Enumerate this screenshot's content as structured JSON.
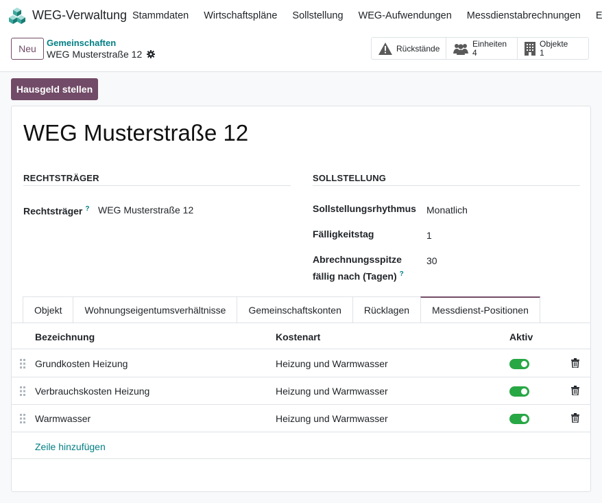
{
  "app": {
    "name": "WEG-Verwaltung"
  },
  "menu": [
    "Stammdaten",
    "Wirtschaftspläne",
    "Sollstellung",
    "WEG-Aufwendungen",
    "Messdienstabrechnungen",
    "Eröffn"
  ],
  "control": {
    "new_label": "Neu",
    "breadcrumb_parent": "Gemeinschaften",
    "breadcrumb_current": "WEG Musterstraße 12"
  },
  "smart_buttons": {
    "rueckstaende": "Rückstände",
    "einheiten_label": "Einheiten",
    "einheiten_count": "4",
    "objekte_label": "Objekte",
    "objekte_count": "1"
  },
  "primary_action": "Hausgeld stellen",
  "record": {
    "title": "WEG Musterstraße 12",
    "group_left": "RECHTSTRÄGER",
    "group_right": "SOLLSTELLUNG",
    "rechtstraeger_label": "Rechtsträger",
    "rechtstraeger_value": "WEG Musterstraße 12",
    "help_mark": "?",
    "rhythmus_label": "Sollstellungsrhythmus",
    "rhythmus_value": "Monatlich",
    "faelligkeit_label": "Fälligkeitstag",
    "faelligkeit_value": "1",
    "spitze_label_1": "Abrechnungsspitze",
    "spitze_label_2": "fällig nach (Tagen)",
    "spitze_value": "30"
  },
  "tabs": [
    "Objekt",
    "Wohnungseigentumsverhältnisse",
    "Gemeinschaftskonten",
    "Rücklagen",
    "Messdienst-Positionen"
  ],
  "active_tab": 4,
  "table": {
    "headers": [
      "Bezeichnung",
      "Kostenart",
      "Aktiv"
    ],
    "rows": [
      {
        "bezeichnung": "Grundkosten Heizung",
        "kostenart": "Heizung und Warmwasser",
        "aktiv": true
      },
      {
        "bezeichnung": "Verbrauchskosten Heizung",
        "kostenart": "Heizung und Warmwasser",
        "aktiv": true
      },
      {
        "bezeichnung": "Warmwasser",
        "kostenart": "Heizung und Warmwasser",
        "aktiv": true
      }
    ],
    "add_line": "Zeile hinzufügen"
  },
  "colors": {
    "brand": "#714b67",
    "link": "#017e84",
    "toggle_on": "#28a745"
  }
}
